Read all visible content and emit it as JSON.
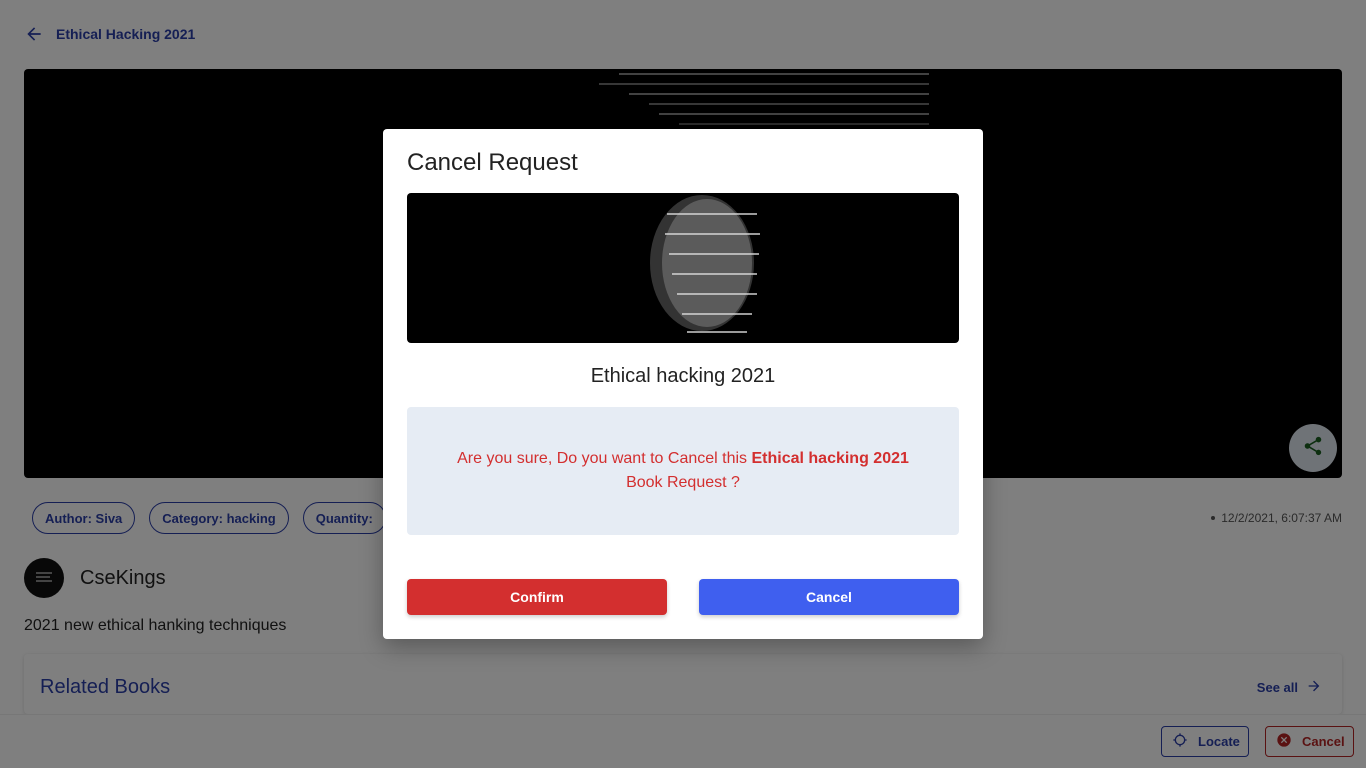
{
  "header": {
    "back_icon": "arrow-left-icon",
    "title": "Ethical Hacking 2021"
  },
  "book": {
    "chips": {
      "author": "Author: Siva",
      "category": "Category: hacking",
      "quantity": "Quantity:"
    },
    "timestamp": "12/2/2021, 6:07:37 AM",
    "owner_name": "CseKings",
    "description": "2021 new ethical hanking techniques"
  },
  "related": {
    "title": "Related Books",
    "see_all": "See all"
  },
  "bottom_bar": {
    "locate_label": "Locate",
    "cancel_label": "Cancel"
  },
  "modal": {
    "title": "Cancel Request",
    "book_title": "Ethical hacking 2021",
    "message_prefix": "Are you sure, Do you want to Cancel this ",
    "message_book": "Ethical hacking 2021",
    "message_suffix": " Book Request ?",
    "confirm_label": "Confirm",
    "cancel_label": "Cancel"
  },
  "colors": {
    "primary": "#2b3ea8",
    "danger": "#d32f2f",
    "accent_button": "#3f5fef",
    "confirm_box_bg": "#e6ecf4"
  }
}
